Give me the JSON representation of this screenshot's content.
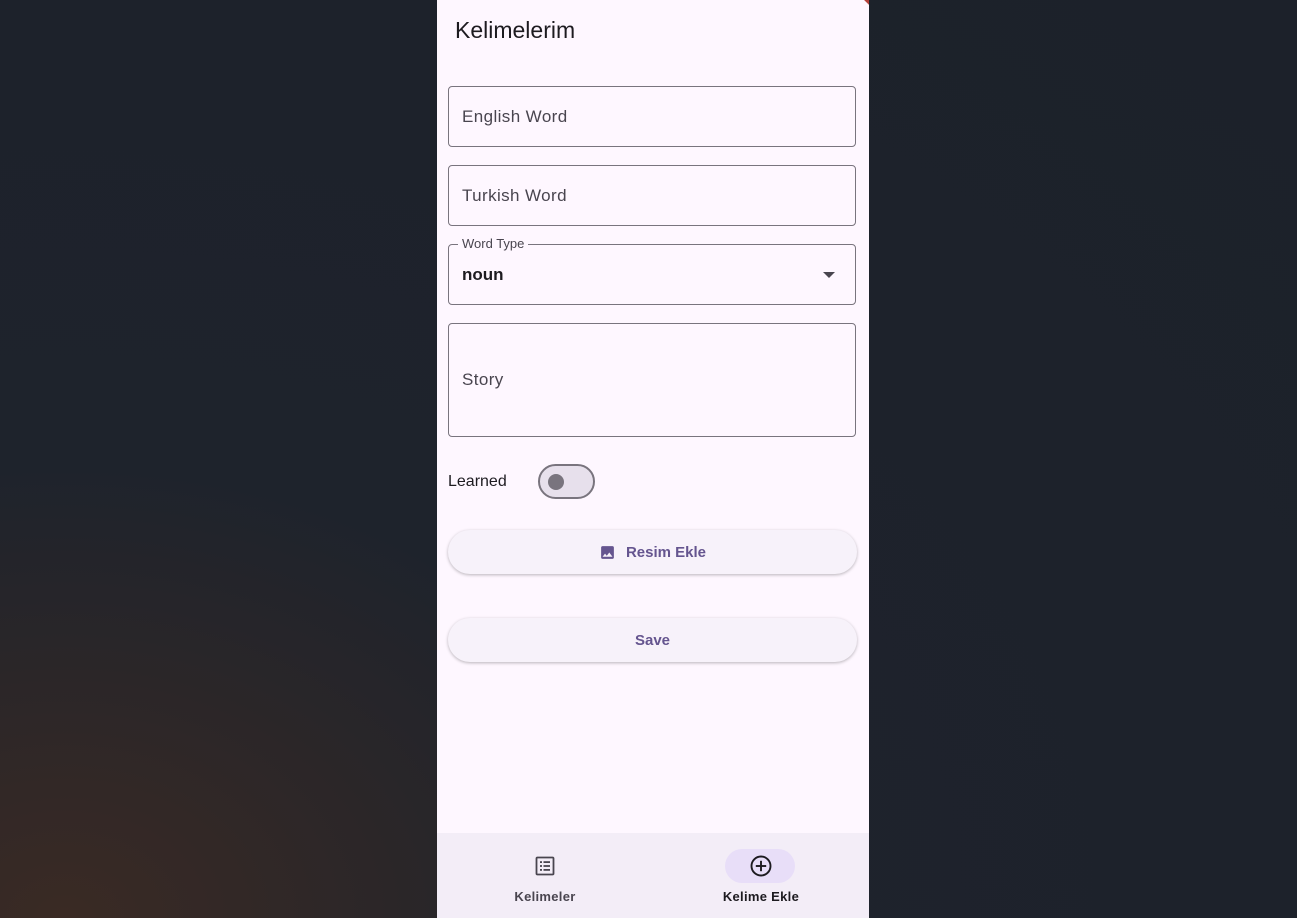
{
  "app": {
    "title": "Kelimelerim"
  },
  "form": {
    "english_placeholder": "English Word",
    "turkish_placeholder": "Turkish Word",
    "word_type_label": "Word Type",
    "word_type_value": "noun",
    "story_placeholder": "Story",
    "learned_label": "Learned",
    "learned_on": false,
    "image_button_label": "Resim Ekle",
    "image_button_icon": "image-icon",
    "save_button_label": "Save"
  },
  "bottom_nav": {
    "items": [
      {
        "label": "Kelimeler",
        "icon": "list-icon",
        "selected": false
      },
      {
        "label": "Kelime Ekle",
        "icon": "add-circle-icon",
        "selected": true
      }
    ]
  },
  "colors": {
    "background": "#fef7ff",
    "primary": "#65558f",
    "outline": "#79747e",
    "nav_indicator": "#e8def8",
    "debug_banner": "#b3413a"
  }
}
